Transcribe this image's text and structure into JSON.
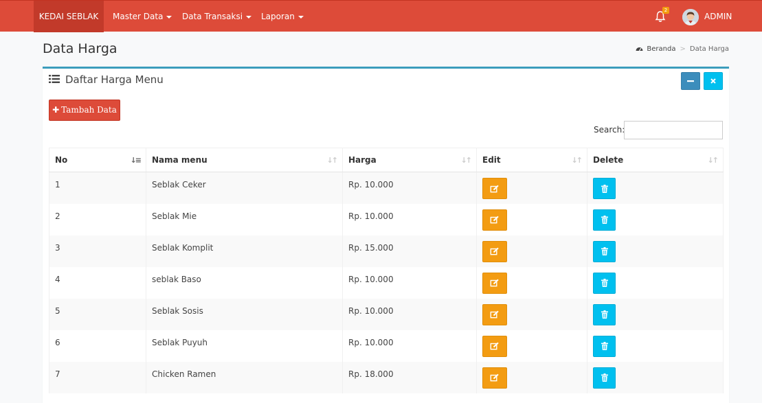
{
  "navbar": {
    "brand": "KEDAI SEBLAK",
    "menu": [
      {
        "label": "Master Data"
      },
      {
        "label": "Data Transaksi"
      },
      {
        "label": "Laporan"
      }
    ],
    "notification_count": "2",
    "user_name": "ADMIN",
    "color": "#dd4b39"
  },
  "page": {
    "title": "Data Harga",
    "breadcrumb": {
      "home": "Beranda",
      "current": "Data Harga"
    }
  },
  "box": {
    "title": "Daftar Harga Menu",
    "add_button": "Tambah Data",
    "search_label": "Search:",
    "search_value": ""
  },
  "table": {
    "columns": [
      "No",
      "Nama menu",
      "Harga",
      "Edit",
      "Delete"
    ],
    "rows": [
      {
        "no": "1",
        "nama": "Seblak Ceker",
        "harga": "Rp. 10.000"
      },
      {
        "no": "2",
        "nama": "Seblak Mie",
        "harga": "Rp. 10.000"
      },
      {
        "no": "3",
        "nama": "Seblak Komplit",
        "harga": "Rp. 15.000"
      },
      {
        "no": "4",
        "nama": "seblak Baso",
        "harga": "Rp. 10.000"
      },
      {
        "no": "5",
        "nama": "Seblak Sosis",
        "harga": "Rp. 10.000"
      },
      {
        "no": "6",
        "nama": "Seblak Puyuh",
        "harga": "Rp. 10.000"
      },
      {
        "no": "7",
        "nama": "Chicken Ramen",
        "harga": "Rp. 18.000"
      }
    ],
    "edit_icon": "edit-icon",
    "delete_icon": "trash-icon",
    "edit_color": "#f39c12",
    "delete_color": "#00c0ef"
  }
}
